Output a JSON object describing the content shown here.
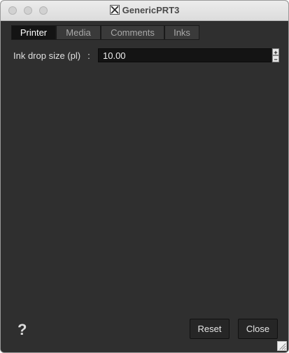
{
  "window": {
    "title": "GenericPRT3",
    "title_icon": "x11-icon"
  },
  "tabs": [
    {
      "label": "Printer",
      "active": true
    },
    {
      "label": "Media",
      "active": false
    },
    {
      "label": "Comments",
      "active": false
    },
    {
      "label": "Inks",
      "active": false
    }
  ],
  "fields": {
    "ink_drop_size": {
      "label": "Ink drop size (pl)",
      "separator": ":",
      "value": "10.00",
      "increment_symbol": "+",
      "decrement_symbol": "−"
    }
  },
  "footer": {
    "help_label": "?",
    "reset_label": "Reset",
    "close_label": "Close"
  }
}
